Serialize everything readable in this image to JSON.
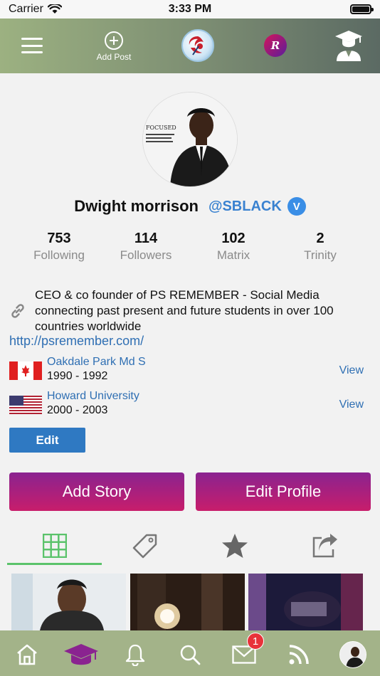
{
  "status_bar": {
    "carrier": "Carrier",
    "time": "3:33 PM"
  },
  "top_bar": {
    "add_post_label": "Add Post",
    "r_logo_letter": "R",
    "icons": [
      "hamburger-menu-icon",
      "add-post-icon",
      "ps-remember-logo",
      "r-logo",
      "graduate-icon"
    ]
  },
  "profile": {
    "avatar_caption_title": "FOCUSED",
    "display_name": "Dwight morrison",
    "handle": "@SBLACK",
    "verified_letter": "V",
    "stats": [
      {
        "value": "753",
        "label": "Following"
      },
      {
        "value": "114",
        "label": "Followers"
      },
      {
        "value": "102",
        "label": "Matrix"
      },
      {
        "value": "2",
        "label": "Trinity"
      }
    ],
    "bio": "CEO & co founder of PS REMEMBER - Social Media connecting past present and future students in over 100 countries worldwide",
    "website": "http://psremember.com/",
    "education": [
      {
        "flag": "canada-flag",
        "school": "Oakdale Park Md S",
        "years": "1990 - 1992",
        "view_label": "View"
      },
      {
        "flag": "usa-flag",
        "school": "Howard University",
        "years": "2000 - 2003",
        "view_label": "View"
      }
    ],
    "edit_label": "Edit"
  },
  "actions": {
    "add_story": "Add Story",
    "edit_profile": "Edit Profile"
  },
  "tabs": [
    "grid-icon",
    "tag-icon",
    "star-icon",
    "share-icon"
  ],
  "active_tab_color": "#5bc36b",
  "bottom_nav": {
    "items": [
      "home-icon",
      "graduation-cap-icon",
      "bell-icon",
      "search-icon",
      "mail-icon",
      "rss-icon",
      "profile-avatar"
    ],
    "mail_badge": "1"
  },
  "colors": {
    "accent_gradient_start": "#8a2390",
    "accent_gradient_end": "#c81d6b",
    "link": "#2f6fb3",
    "edit_button": "#2f79c2",
    "bottom_bar": "#a3b389"
  }
}
